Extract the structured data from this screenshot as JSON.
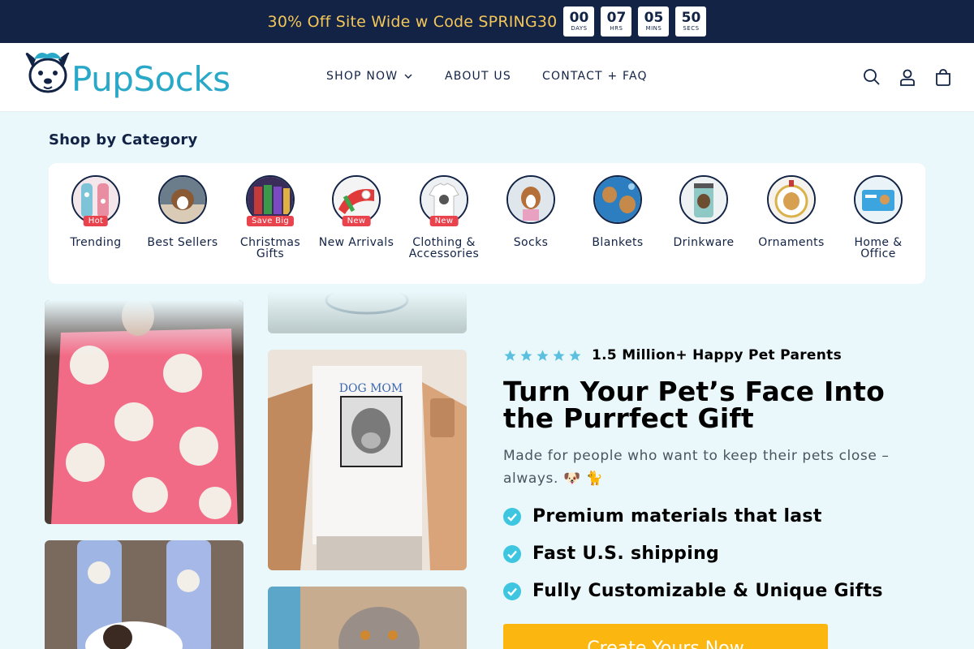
{
  "announcement": {
    "text": "30% Off Site Wide w Code SPRING30",
    "countdown": [
      {
        "num": "00",
        "label": "DAYS"
      },
      {
        "num": "07",
        "label": "HRS"
      },
      {
        "num": "05",
        "label": "MINS"
      },
      {
        "num": "50",
        "label": "SECS"
      }
    ]
  },
  "header": {
    "logo": "PupSocks",
    "nav": [
      {
        "label": "SHOP NOW"
      },
      {
        "label": "ABOUT US"
      },
      {
        "label": "CONTACT + FAQ"
      }
    ],
    "icons": [
      "search-icon",
      "account-icon",
      "cart-icon"
    ]
  },
  "categories": {
    "title": "Shop by Category",
    "items": [
      {
        "label": "Trending",
        "badge": "Hot"
      },
      {
        "label": "Best Sellers",
        "badge": ""
      },
      {
        "label": "Christmas Gifts",
        "badge": "Save Big"
      },
      {
        "label": "New Arrivals",
        "badge": "New"
      },
      {
        "label": "Clothing & Accessories",
        "badge": "New"
      },
      {
        "label": "Socks",
        "badge": ""
      },
      {
        "label": "Blankets",
        "badge": ""
      },
      {
        "label": "Drinkware",
        "badge": ""
      },
      {
        "label": "Ornaments",
        "badge": ""
      },
      {
        "label": "Home & Office",
        "badge": ""
      }
    ]
  },
  "hero": {
    "rating_text": "1.5 Million+ Happy Pet Parents",
    "title": "Turn Your Pet’s Face Into the Purrfect Gift",
    "subtitle": "Made for people who want to keep their pets close – always. 🐶 🐈",
    "features": [
      "Premium materials that last",
      "Fast U.S. shipping",
      "Fully Customizable & Unique Gifts"
    ],
    "cta": "Create Yours Now",
    "tshirt_print": "DOG MOM"
  },
  "colors": {
    "topbar": "#122346",
    "accent_gold": "#f4c65a",
    "brand_blue": "#29a8c8",
    "badge_red": "#e9434e",
    "check": "#3ec6e0",
    "cta": "#fbb60f"
  }
}
